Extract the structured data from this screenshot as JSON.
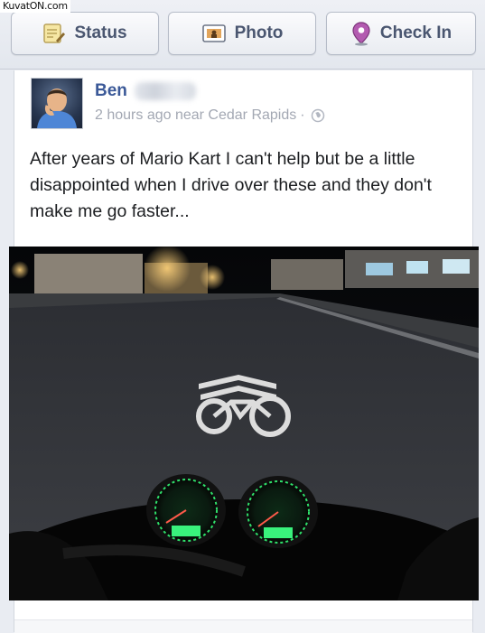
{
  "watermark": "KuvatON.com",
  "composer": {
    "status_label": "Status",
    "photo_label": "Photo",
    "checkin_label": "Check In"
  },
  "post": {
    "author_first": "Ben",
    "time": "2 hours ago near Cedar Rapids",
    "separator": "·",
    "text": "After years of Mario Kart I can't help but be a little disappointed when I drive over these and they don't make me go faster..."
  },
  "icons": {
    "status": "note-pencil-icon",
    "photo": "photo-icon",
    "checkin": "location-pin-icon",
    "privacy": "globe-icon"
  },
  "colors": {
    "name_link": "#3b5998",
    "meta_gray": "#a3a8b3",
    "button_text": "#4a5670",
    "gauge_green": "#2fe06a"
  }
}
